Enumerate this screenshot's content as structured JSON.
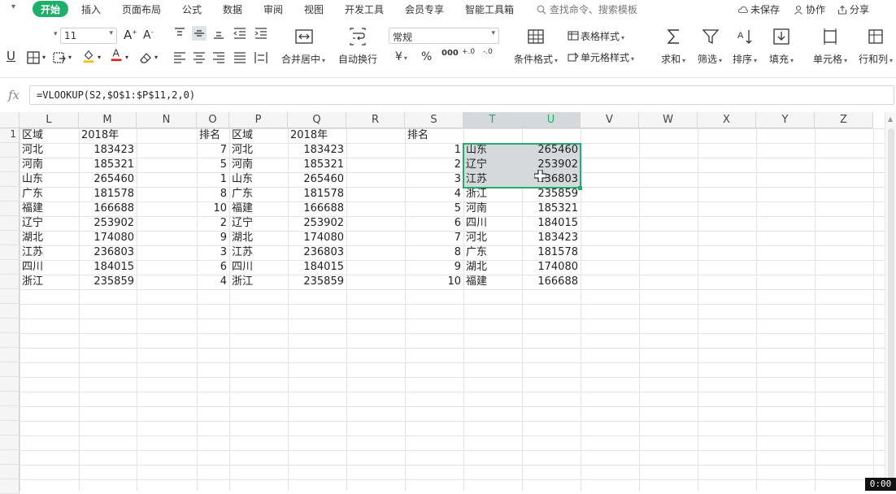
{
  "menu": {
    "tabs": [
      "插入",
      "页面布局",
      "公式",
      "数据",
      "审阅",
      "视图",
      "开发工具",
      "会员专享",
      "智能工具箱"
    ],
    "active_tab": "开始",
    "search_placeholder": "查找命令、搜索模板",
    "unsaved": "未保存",
    "collab": "协作",
    "share": "分享"
  },
  "ribbon": {
    "font_size": "11",
    "merge_center": "合并居中",
    "wrap_text": "自动换行",
    "number_format": "常规",
    "conditional_format": "条件格式",
    "table_style": "表格样式",
    "cell_style": "单元格样式",
    "sum": "求和",
    "filter": "筛选",
    "sort": "排序",
    "fill": "填充",
    "cell": "单元格",
    "row_col": "行和列",
    "currency_symbol": "¥",
    "percent_symbol": "%",
    "thousands_symbol": "000",
    "dec_inc": "+.0",
    "dec_dec": "-.0"
  },
  "formula_bar": {
    "fx": "fx",
    "formula": "=VLOOKUP(S2,$O$1:$P$11,2,0)"
  },
  "columns": [
    "L",
    "M",
    "N",
    "O",
    "P",
    "Q",
    "R",
    "S",
    "T",
    "U",
    "V",
    "W",
    "X",
    "Y",
    "Z"
  ],
  "selected_columns": [
    "T",
    "U"
  ],
  "row_headers": [
    "1"
  ],
  "headers_row": {
    "L": "区域",
    "M": "2018年",
    "O": "排名",
    "P": "区域",
    "Q": "2018年",
    "S": "排名"
  },
  "table1": {
    "regions": [
      "河北",
      "河南",
      "山东",
      "广东",
      "福建",
      "辽宁",
      "湖北",
      "江苏",
      "四川",
      "浙江"
    ],
    "values": [
      "183423",
      "185321",
      "265460",
      "181578",
      "166688",
      "253902",
      "174080",
      "236803",
      "184015",
      "235859"
    ]
  },
  "table2": {
    "ranks": [
      "7",
      "5",
      "1",
      "8",
      "10",
      "2",
      "9",
      "3",
      "6",
      "4"
    ],
    "regions": [
      "河北",
      "河南",
      "山东",
      "广东",
      "福建",
      "辽宁",
      "湖北",
      "江苏",
      "四川",
      "浙江"
    ],
    "values": [
      "183423",
      "185321",
      "265460",
      "181578",
      "166688",
      "253902",
      "174080",
      "236803",
      "184015",
      "235859"
    ]
  },
  "table3": {
    "ranks": [
      "1",
      "2",
      "3",
      "4",
      "5",
      "6",
      "7",
      "8",
      "9",
      "10"
    ],
    "regions": [
      "山东",
      "辽宁",
      "江苏",
      "浙江",
      "河南",
      "四川",
      "河北",
      "广东",
      "湖北",
      "福建"
    ],
    "values": [
      "265460",
      "253902",
      "236803",
      "235859",
      "185321",
      "184015",
      "183423",
      "181578",
      "174080",
      "166688"
    ]
  },
  "timer": "0:00",
  "colors": {
    "accent": "#1eaf6a",
    "selection_fill": "#d6d9dc"
  }
}
